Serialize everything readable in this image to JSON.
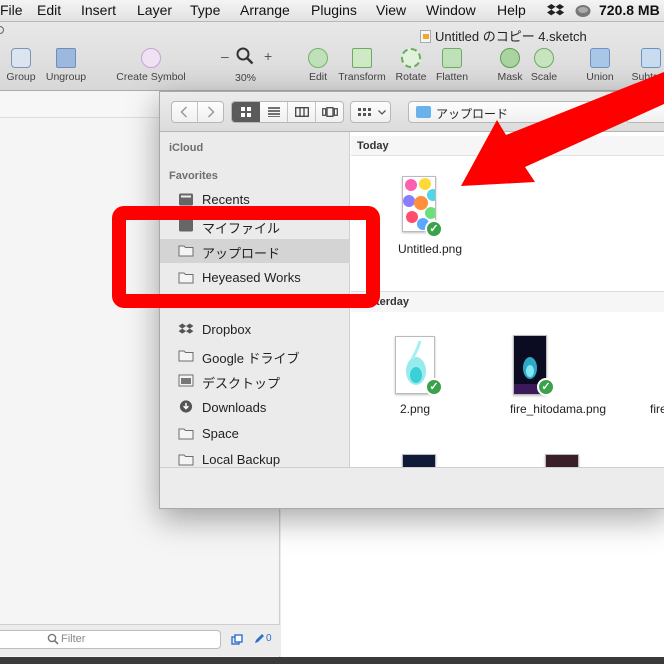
{
  "menubar": {
    "items": [
      "File",
      "Edit",
      "Insert",
      "Layer",
      "Type",
      "Arrange",
      "Plugins",
      "View",
      "Window",
      "Help"
    ],
    "memory": "720.8 MB"
  },
  "document": {
    "title": "Untitled のコピー 4.sketch"
  },
  "toolbar": {
    "group": "Group",
    "ungroup": "Ungroup",
    "create_symbol": "Create Symbol",
    "zoom_minus": "–",
    "zoom_plus": "+",
    "zoom": "30%",
    "edit": "Edit",
    "transform": "Transform",
    "rotate": "Rotate",
    "flatten": "Flatten",
    "mask": "Mask",
    "scale": "Scale",
    "union": "Union",
    "subtract": "Subtract"
  },
  "filter": {
    "placeholder": "Filter",
    "count": "0"
  },
  "dialog": {
    "location": "アップロード",
    "sidebar": {
      "icloud": "iCloud",
      "favorites": "Favorites",
      "items": [
        "Recents",
        "マイファイル",
        "アップロード",
        "Heyeased Works",
        "Dropbox",
        "Google ドライブ",
        "デスクトップ",
        "Downloads",
        "Space",
        "Local Backup"
      ]
    },
    "sections": {
      "today": "Today",
      "yesterday": "Yesterday"
    },
    "files": {
      "today": [
        "Untitled.png"
      ],
      "yesterday": [
        "2.png",
        "fire_hitodama.png",
        "fire"
      ]
    }
  },
  "colors": {
    "annotation": "#ff0000",
    "check": "#3aa24a",
    "selection": "#d4d4d4"
  }
}
